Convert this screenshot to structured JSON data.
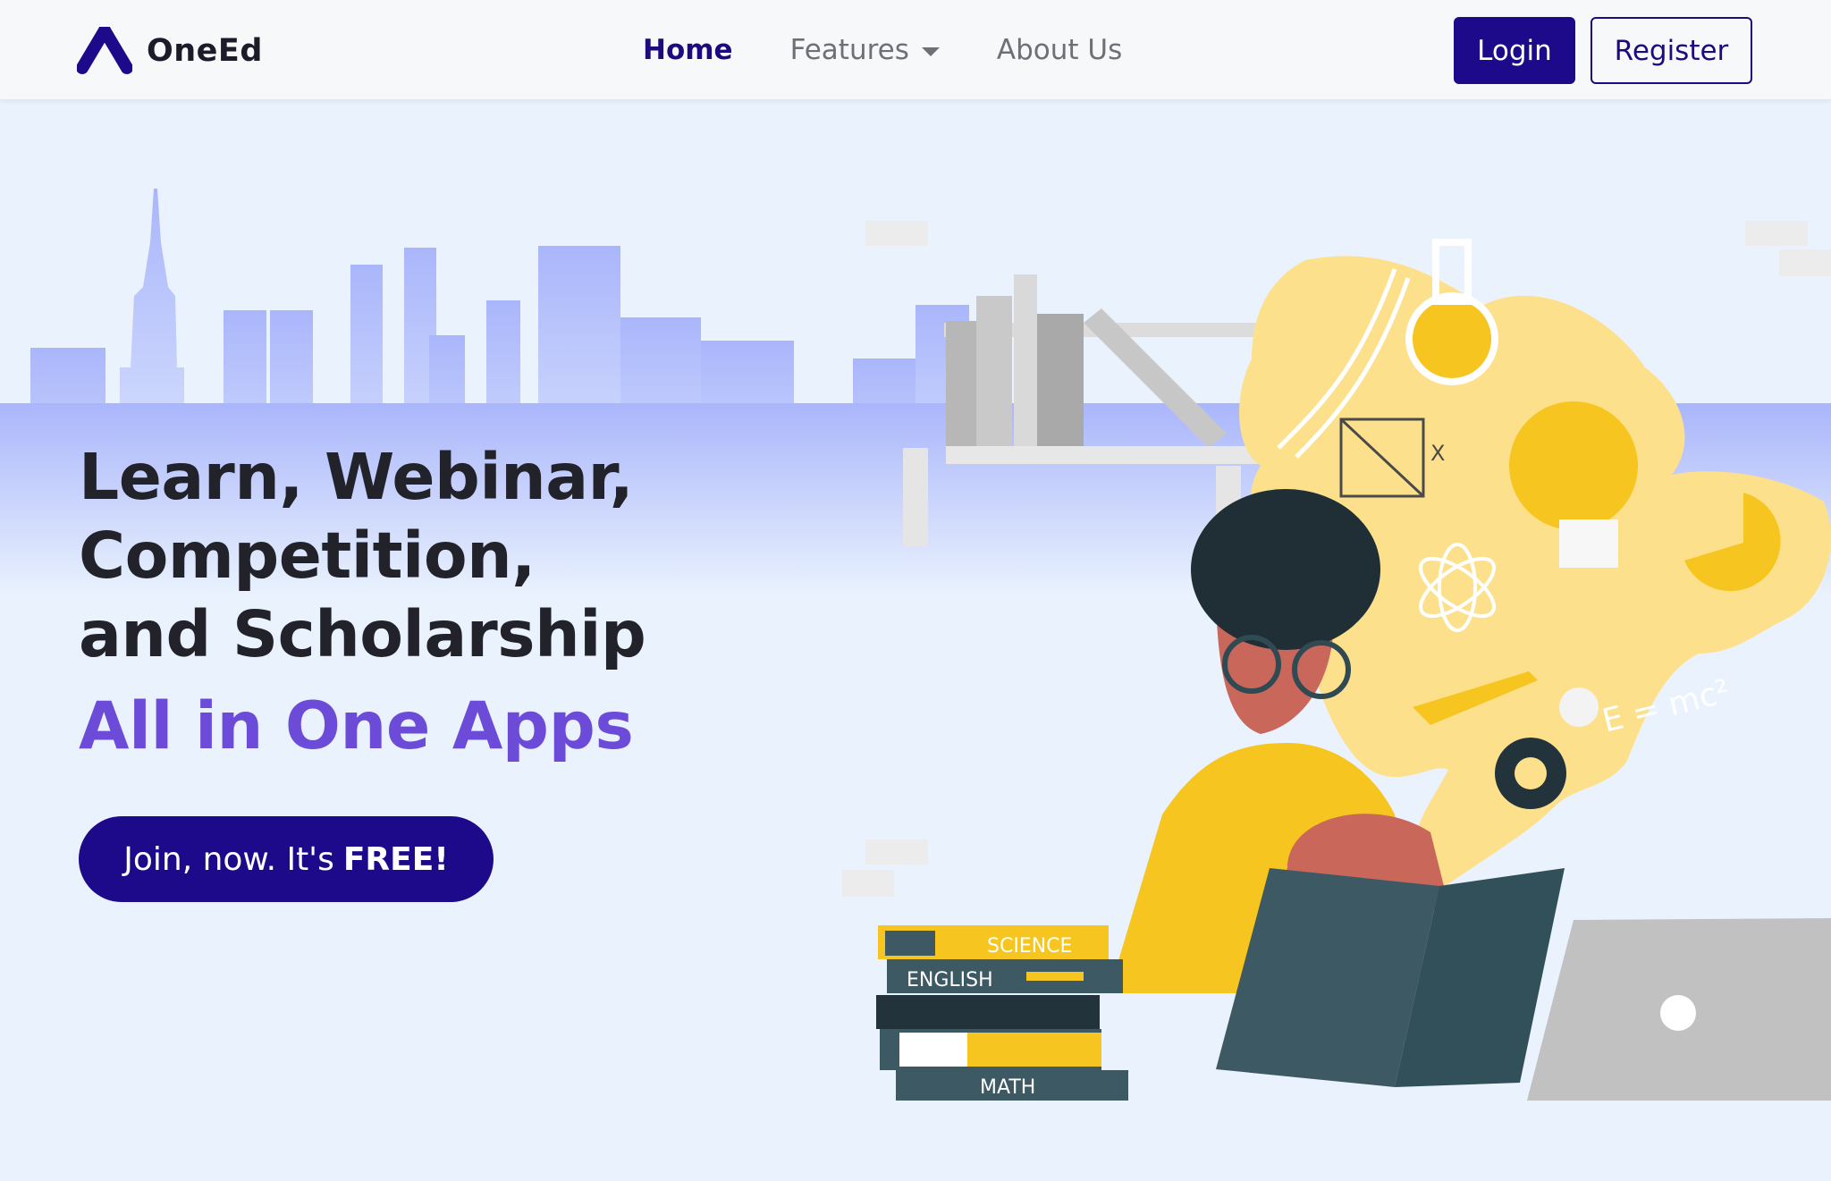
{
  "brand": {
    "name": "OneEd",
    "logo_icon": "oneed-logo-icon"
  },
  "nav": {
    "home": "Home",
    "features": "Features",
    "about": "About Us",
    "login": "Login",
    "register": "Register"
  },
  "hero": {
    "headline_line1": "Learn, Webinar, Competition,",
    "headline_line2": "and Scholarship",
    "tagline": "All in One Apps",
    "cta_prefix": "Join, now. It's",
    "cta_strong": "FREE!"
  },
  "illustration": {
    "book_labels": [
      "SCIENCE",
      "ENGLISH",
      "MATH"
    ],
    "formula": "E = mc²",
    "math_mark": "X"
  },
  "colors": {
    "primary": "#1d0a8a",
    "accent_purple": "#6c4bd8",
    "background": "#eaf3fd",
    "illustration_yellow": "#f7c51f",
    "skin": "#c8675a"
  }
}
